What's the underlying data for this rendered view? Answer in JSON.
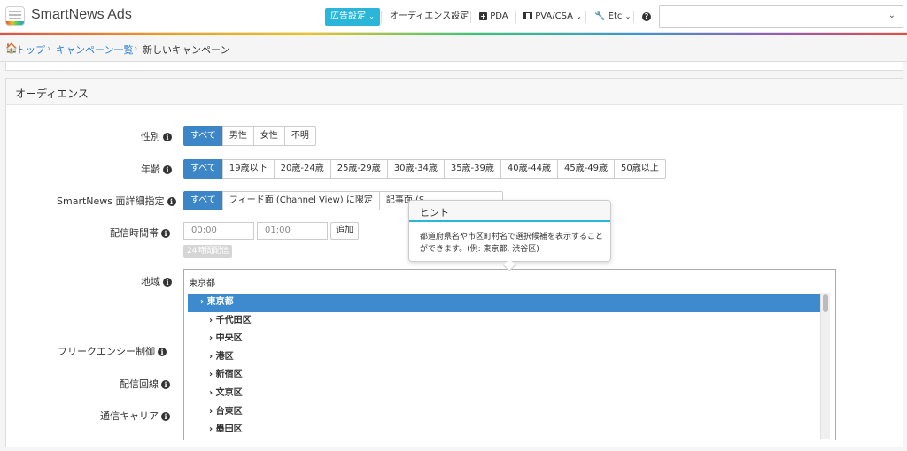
{
  "app": {
    "title": "SmartNews Ads"
  },
  "nav": {
    "ad_settings": "広告設定",
    "audience_settings": "オーディエンス設定",
    "pda": "PDA",
    "pva_csa": "PVA/CSA",
    "etc": "Etc",
    "help_icon": "question-circle-icon",
    "select_value": ""
  },
  "breadcrumb": {
    "home": "トップ",
    "campaign_list": "キャンペーン一覧",
    "current": "新しいキャンペーン"
  },
  "panel": {
    "title": "オーディエンス"
  },
  "gender": {
    "label": "性別",
    "options": [
      "すべて",
      "男性",
      "女性",
      "不明"
    ],
    "selected": "すべて"
  },
  "age": {
    "label": "年齢",
    "options": [
      "すべて",
      "19歳以下",
      "20歳-24歳",
      "25歳-29歳",
      "30歳-34歳",
      "35歳-39歳",
      "40歳-44歳",
      "45歳-49歳",
      "50歳以上"
    ],
    "selected": "すべて"
  },
  "surface": {
    "label": "SmartNews 面詳細指定",
    "options": [
      "すべて",
      "フィード面 (Channel View) に限定",
      "記事面 (S"
    ],
    "selected": "すべて"
  },
  "delivery_time": {
    "label": "配信時間帯",
    "start": "00:00",
    "end": "01:00",
    "add_button": "追加",
    "all_day_button": "24時間配信"
  },
  "region": {
    "label": "地域",
    "value": "東京都",
    "items": [
      "東京都",
      "千代田区",
      "中央区",
      "港区",
      "新宿区",
      "文京区",
      "台東区",
      "墨田区"
    ],
    "selected": "東京都"
  },
  "frequency": {
    "label": "フリークエンシー制御"
  },
  "line": {
    "label": "配信回線"
  },
  "carrier": {
    "label": "通信キャリア"
  },
  "hint": {
    "title": "ヒント",
    "body": "都道府県名や市区町村名で選択候補を表示することができます。(例: 東京都, 渋谷区)"
  },
  "colors": {
    "accent": "#29b6d9",
    "selected": "#3c85c6",
    "link": "#2a7fd4"
  }
}
